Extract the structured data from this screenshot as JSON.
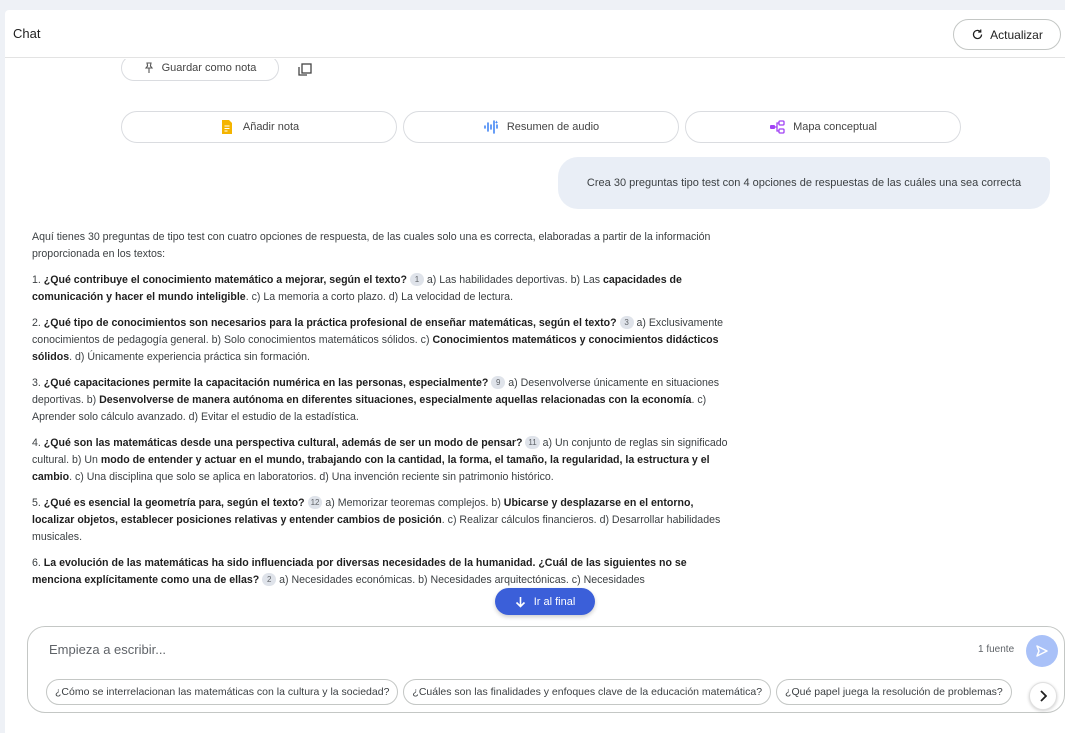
{
  "header": {
    "title": "Chat",
    "refresh_label": "Actualizar"
  },
  "note_tools": {
    "save_note_label": "Guardar como nota"
  },
  "actions": [
    {
      "label": "Añadir nota",
      "icon": "note-icon",
      "color": "#f4b400"
    },
    {
      "label": "Resumen de audio",
      "icon": "audio-waveform-icon",
      "color": "#4285f4"
    },
    {
      "label": "Mapa conceptual",
      "icon": "mind-map-icon",
      "color": "#a142f4"
    }
  ],
  "user_message": "Crea 30 preguntas tipo test con 4 opciones de respuestas de las cuáles una sea correcta",
  "answer": {
    "intro": "Aquí tienes 30 preguntas de tipo test con cuatro opciones de respuesta, de las cuales solo una es correcta, elaboradas a partir de la información proporcionada en los textos:",
    "q1": {
      "a": "1. ",
      "b": "¿Qué contribuye el conocimiento matemático a mejorar, según el texto?",
      "c": "1",
      "d": " a) Las habilidades deportivas. b) Las ",
      "e": "capacidades de comunicación y hacer el mundo inteligible",
      "f": ". c) La memoria a corto plazo. d) La velocidad de lectura."
    },
    "q2": {
      "a": "2. ",
      "b": "¿Qué tipo de conocimientos son necesarios para la práctica profesional de enseñar matemáticas, según el texto?",
      "c": "3",
      "d": " a) Exclusivamente conocimientos de pedagogía general. b) Solo conocimientos matemáticos sólidos. c) ",
      "e": "Conocimientos matemáticos y conocimientos didácticos sólidos",
      "f": ". d) Únicamente experiencia práctica sin formación."
    },
    "q3": {
      "a": "3. ",
      "b": "¿Qué capacitaciones permite la capacitación numérica en las personas, especialmente?",
      "c": "9",
      "d": " a) Desenvolverse únicamente en situaciones deportivas. b) ",
      "e": "Desenvolverse de manera autónoma en diferentes situaciones, especialmente aquellas relacionadas con la economía",
      "f": ". c) Aprender solo cálculo avanzado. d) Evitar el estudio de la estadística."
    },
    "q4": {
      "a": "4. ",
      "b": "¿Qué son las matemáticas desde una perspectiva cultural, además de ser un modo de pensar?",
      "c": "11",
      "d": " a) Un conjunto de reglas sin significado cultural. b) Un ",
      "e": "modo de entender y actuar en el mundo, trabajando con la cantidad, la forma, el tamaño, la regularidad, la estructura y el cambio",
      "f": ". c) Una disciplina que solo se aplica en laboratorios. d) Una invención reciente sin patrimonio histórico."
    },
    "q5": {
      "a": "5. ",
      "b": "¿Qué es esencial la geometría para, según el texto?",
      "c": "12",
      "d": " a) Memorizar teoremas complejos. b) ",
      "e": "Ubicarse y desplazarse en el entorno, localizar objetos, establecer posiciones relativas y entender cambios de posición",
      "f": ". c) Realizar cálculos financieros. d) Desarrollar habilidades musicales."
    },
    "q6": {
      "a": "6. ",
      "b": "La evolución de las matemáticas ha sido influenciada por diversas necesidades de la humanidad. ¿Cuál de las siguientes no se menciona explícitamente como una de ellas?",
      "c": "2",
      "d": " a) Necesidades económicas. b) Necesidades arquitectónicas. c) Necesidades"
    }
  },
  "goto_end_label": "Ir al final",
  "composer": {
    "placeholder": "Empieza a escribir...",
    "sources": "1 fuente",
    "suggestions": [
      "¿Cómo se interrelacionan las matemáticas con la cultura y la sociedad?",
      "¿Cuáles son las finalidades y enfoques clave de la educación matemática?",
      "¿Qué papel juega la resolución de problemas?"
    ]
  },
  "colors": {
    "accent": "#3b5fd9",
    "send_disabled": "#a9c1f8",
    "user_bubble": "#e9eef6"
  }
}
